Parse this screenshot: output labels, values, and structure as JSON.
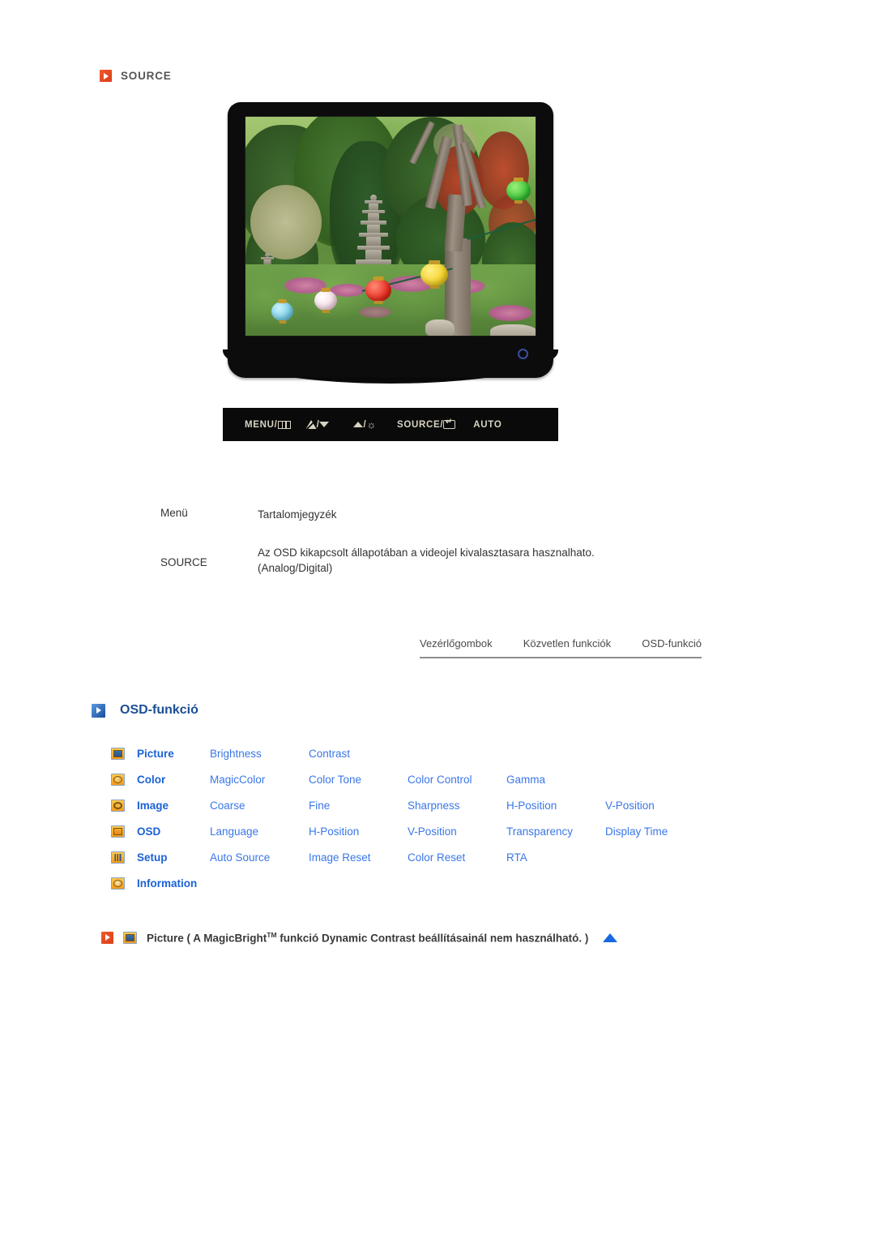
{
  "source_section": {
    "heading": "SOURCE",
    "bullet_icon": "orange-play-bullet-icon",
    "accent_color": "#E0451C"
  },
  "monitor": {
    "screen_image_description": "Korean temple garden with stone pagoda, trees and colorful paper lanterns",
    "power_led": "blue-power-led",
    "control_buttons": [
      {
        "label": "MENU/",
        "glyph": "menu-box-icon"
      },
      {
        "label": "/",
        "glyph": "magicbright-down-icon"
      },
      {
        "label": "/",
        "glyph": "up-brightness-icon"
      },
      {
        "label": "SOURCE/",
        "glyph": "enter-icon"
      },
      {
        "label": "AUTO",
        "glyph": ""
      }
    ]
  },
  "menu_table": {
    "headers": {
      "menu": "Menü",
      "contents": "Tartalomjegyzék"
    },
    "rows": [
      {
        "menu": "SOURCE",
        "description_line1": "Az OSD kikapcsolt állapotában a videojel kivalasztasara hasznalhato.",
        "description_line2": "(Analog/Digital)"
      }
    ]
  },
  "tab_nav": {
    "tabs": [
      {
        "label": "Vezérlőgombok"
      },
      {
        "label": "Közvetlen funkciók"
      },
      {
        "label": "OSD-funkció"
      }
    ]
  },
  "osd_section": {
    "heading": "OSD-funkció",
    "bullet_icon": "blue-play-bullet-icon",
    "heading_color": "#1C4F94",
    "link_color": "#3A77E8",
    "category_color": "#1B62D6",
    "rows": [
      {
        "icon": "picture-icon",
        "category": "Picture",
        "items": [
          "Brightness",
          "Contrast"
        ]
      },
      {
        "icon": "color-icon",
        "category": "Color",
        "items": [
          "MagicColor",
          "Color Tone",
          "Color Control",
          "Gamma"
        ]
      },
      {
        "icon": "image-icon",
        "category": "Image",
        "items": [
          "Coarse",
          "Fine",
          "Sharpness",
          "H-Position",
          "V-Position"
        ]
      },
      {
        "icon": "osd-icon",
        "category": "OSD",
        "items": [
          "Language",
          "H-Position",
          "V-Position",
          "Transparency",
          "Display Time"
        ]
      },
      {
        "icon": "setup-icon",
        "category": "Setup",
        "items": [
          "Auto Source",
          "Image Reset",
          "Color Reset",
          "RTA"
        ]
      },
      {
        "icon": "information-icon",
        "category": "Information",
        "items": []
      }
    ]
  },
  "footer_note": {
    "bullet_icon": "orange-play-bullet-icon",
    "picture_icon": "picture-icon",
    "text_before_tm": "Picture ( A MagicBright",
    "tm": "TM",
    "text_after_tm": " funkció Dynamic Contrast beállításainál nem használható. )",
    "top_arrow_icon": "scroll-to-top-arrow-icon",
    "arrow_color": "#1669E0"
  }
}
